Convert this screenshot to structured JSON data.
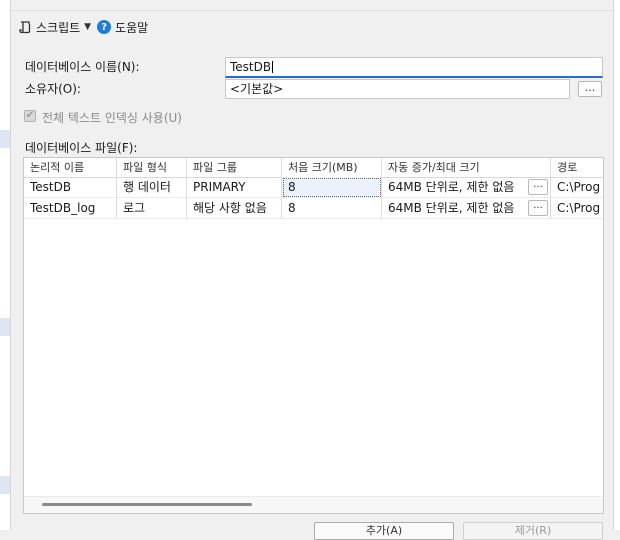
{
  "toolbar": {
    "script_label": "스크립트",
    "help_label": "도움말"
  },
  "form": {
    "db_name_label": "데이터베이스 이름(N):",
    "db_name_value": "TestDB",
    "owner_label": "소유자(O):",
    "owner_value": "<기본값>",
    "owner_browse": "...",
    "fulltext_label": "전체 텍스트 인덱싱 사용(U)",
    "fulltext_checked": true,
    "files_label": "데이터베이스 파일(F):"
  },
  "files_grid": {
    "columns": [
      "논리적 이름",
      "파일 형식",
      "파일 그룹",
      "처음 크기(MB)",
      "자동 증가/최대 크기",
      "경로"
    ],
    "rows": [
      {
        "logical_name": "TestDB",
        "file_type": "행 데이터",
        "filegroup": "PRIMARY",
        "initial_size": "8",
        "autogrowth": "64MB 단위로, 제한 없음",
        "browse": "...",
        "path": "C:\\Prog"
      },
      {
        "logical_name": "TestDB_log",
        "file_type": "로그",
        "filegroup": "해당 사항 없음",
        "initial_size": "8",
        "autogrowth": "64MB 단위로, 제한 없음",
        "browse": "...",
        "path": "C:\\Prog"
      }
    ]
  },
  "bottom_buttons": {
    "add_label": "추가(A)",
    "remove_label": "제거(R)"
  }
}
